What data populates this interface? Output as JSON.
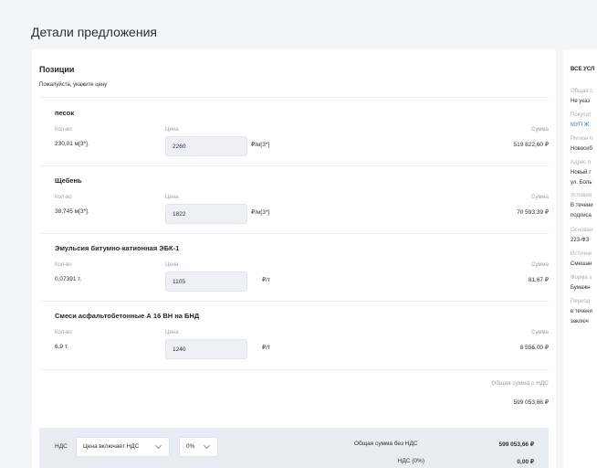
{
  "page": {
    "title": "Детали предложения"
  },
  "positions": {
    "title": "Позиции",
    "subtitle": "Пожалуйста, укажите цену",
    "qty_label": "Кол-во",
    "price_label": "Цена",
    "sum_label": "Сумма",
    "items": [
      {
        "name": "песок",
        "qty": "230,01 м[3*].",
        "price": "2260",
        "unit": "₽/м[3*]",
        "sum": "519 822,60 ₽"
      },
      {
        "name": "Щебень",
        "qty": "38,745 м[3*].",
        "price": "1822",
        "unit": "₽/м[3*]",
        "sum": "70 593,39 ₽"
      },
      {
        "name": "Эмульсия битумно-катионная ЭБК-1",
        "qty": "0,07391 т.",
        "price": "1105",
        "unit": "₽/т",
        "sum": "81,67 ₽"
      },
      {
        "name": "Смеси асфальтобетонные А 16 ВН на БНД",
        "qty": "6,9 т.",
        "price": "1240",
        "unit": "₽/т",
        "sum": "8 556,00 ₽"
      }
    ],
    "total_vat_label": "Общая сумма с НДС",
    "total_vat_value": "599 053,66 ₽"
  },
  "vat": {
    "label": "НДС",
    "mode_selected": "Цена включает НДС",
    "rate_selected": "0%",
    "total_no_vat_label": "Общая сумма без НДС",
    "total_no_vat_value": "599 053,66 ₽",
    "vat_amount_label": "НДС (0%)",
    "vat_amount_value": "0,00 ₽"
  },
  "side": {
    "header": "ВСЕ УСЛ",
    "rows": [
      {
        "label": "Общая с",
        "value": "Не указ"
      },
      {
        "label": "Покупат",
        "value": "МУП Ж"
      },
      {
        "label": "Регион п",
        "value": "Новосиб"
      },
      {
        "label": "Адрес п",
        "value": "Новый г",
        "value2": "ул. Боль"
      },
      {
        "label": "Условия",
        "value": "В течени",
        "value2": "подписа"
      },
      {
        "label": "Основан",
        "value": "223-ФЗ"
      },
      {
        "label": "Источни",
        "value": "Смешан"
      },
      {
        "label": "Форма з",
        "value": "Бумажн"
      },
      {
        "label": "Период",
        "value": "в течени",
        "value2": "заключ"
      }
    ]
  }
}
